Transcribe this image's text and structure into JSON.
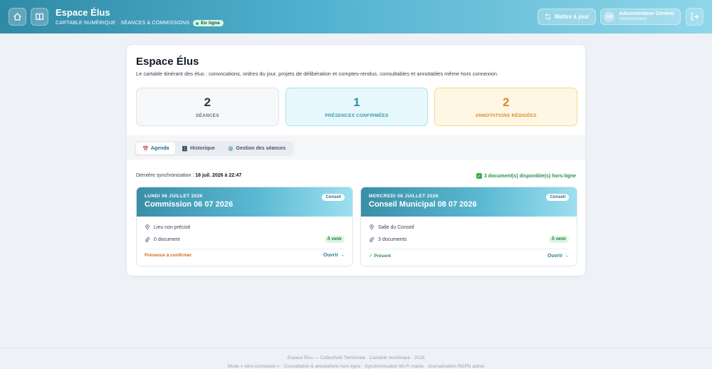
{
  "header": {
    "title": "Espace Élus",
    "subtitle": "CARTABLE NUMÉRIQUE · SÉANCES & COMMISSIONS",
    "online_label": "En ligne",
    "sync_label": "Mettre à jour",
    "user": {
      "initials": "AG",
      "name": "Administrateur Général",
      "role": "Administrateur"
    },
    "colors": {
      "accent": "#3a9fbf",
      "online": "#2fb36b"
    }
  },
  "main": {
    "title": "Espace Élus",
    "description": "Le cartable itinérant des élus : convocations, ordres du jour, projets de délibération et comptes-rendus, consultables et annotables même hors connexion.",
    "stats": [
      {
        "value": "2",
        "label": "SÉANCES"
      },
      {
        "value": "1",
        "label": "PRÉSENCES CONFIRMÉES"
      },
      {
        "value": "2",
        "label": "ANNOTATIONS RÉDIGÉES"
      }
    ],
    "tabs": [
      {
        "icon": "📅",
        "label": "Agenda"
      },
      {
        "icon": "🗄️",
        "label": "Historique"
      },
      {
        "icon": "⚙️",
        "label": "Gestion des séances"
      }
    ],
    "sync": {
      "label": "Dernière synchronisation : ",
      "value": "18 juil. 2026 à 22:47"
    },
    "offline_label": "3 document(s) disponible(s) hors-ligne",
    "sessions": [
      {
        "date": "LUNDI 06 JUILLET 2026",
        "title": "Commission 06 07 2026",
        "type": "Conseil",
        "location": "Lieu non précisé",
        "documents": "0 document",
        "status": "À venir",
        "presence": "Présence à confirmer",
        "open": "Ouvrir →"
      },
      {
        "date": "MERCREDI 08 JUILLET 2026",
        "title": "Conseil Municipal 08 07 2026",
        "type": "Conseil",
        "location": "Salle du Conseil",
        "documents": "3 documents",
        "status": "À venir",
        "presence": "✓ Présent",
        "open": "Ouvrir →"
      }
    ]
  },
  "footer": {
    "line1": "Espace Élus — Collectivité Territoriale · Cartable numérique · 2026",
    "line2": "Mode « zéro connexion » · Consultation & annotations hors-ligne · Synchronisation Wi-Fi mairie · Journalisation RGPD active"
  }
}
